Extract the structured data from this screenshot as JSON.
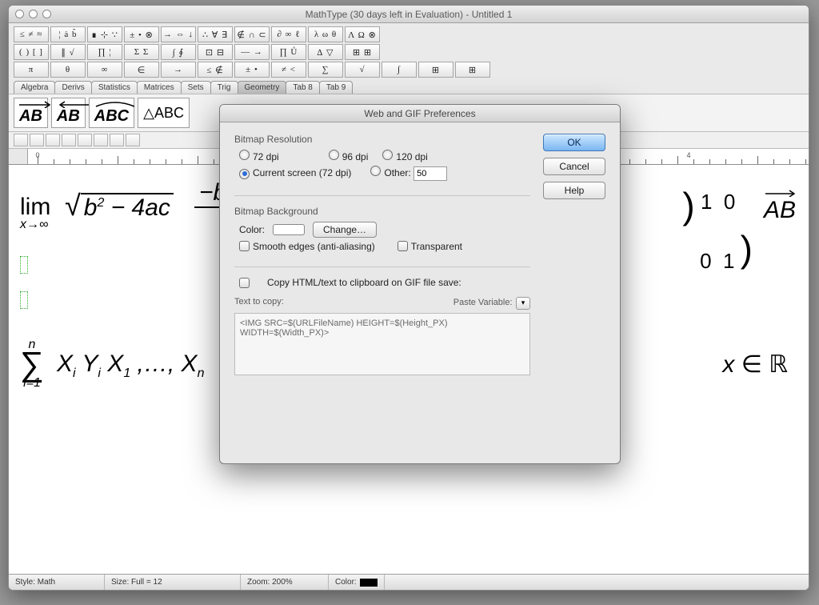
{
  "window": {
    "title": "MathType (30 days left in Evaluation) - Untitled 1"
  },
  "palettes": {
    "row1": [
      "≤ ≠ ≈",
      "¦ ȧ b̂",
      "∎ ⊹ ∵",
      "± • ⊗",
      "→ ⇔ ↓",
      "∴ ∀ ∃",
      "∉ ∩ ⊂",
      "∂ ∞ ℓ",
      "λ ω θ",
      "Λ Ω ⊗"
    ],
    "row2": [
      "( ) [ ]",
      "∥ √",
      "∏ ¦",
      "Σ Σ",
      "∫ ∮",
      "⊡ ⊟",
      "— →",
      "∏ Ů",
      "∆ ▽",
      "⊞ ⊞"
    ],
    "row3": [
      "π",
      "θ",
      "∞",
      "∈",
      "→",
      "≤ ∉",
      "± •",
      "≠ <",
      "∑",
      "√",
      "∫",
      "⊞",
      "⊞"
    ]
  },
  "tabs": [
    "Algebra",
    "Derivs",
    "Statistics",
    "Matrices",
    "Sets",
    "Trig",
    "Geometry",
    "Tab 8",
    "Tab 9"
  ],
  "active_tab": 6,
  "templates": {
    "t1": "AB",
    "t2": "AB",
    "t3": "ABC",
    "t4": "△ABC"
  },
  "ruler_numbers": [
    "0",
    "4"
  ],
  "equations": {
    "lim": "lim",
    "lim_sub": "x→∞",
    "sqrt_inner": "b² − 4ac",
    "frac_num": "−b ±",
    "sum_top": "n",
    "sum_bot": "i=1",
    "sum_body": "X<sub>i</sub> Y<sub>i</sub> X<sub>1</sub> ,…, X<sub>n</sub>",
    "frac2_num": "x",
    "matrix": "1  0\n0  1",
    "vec": "AB",
    "xinr": "x ∈ ℝ"
  },
  "status": {
    "style_label": "Style:",
    "style_value": "Math",
    "size_label": "Size:",
    "size_value": "Full = 12",
    "zoom_label": "Zoom:",
    "zoom_value": "200%",
    "color_label": "Color:"
  },
  "dialog": {
    "title": "Web and GIF Preferences",
    "ok": "OK",
    "cancel": "Cancel",
    "help": "Help",
    "sec1_title": "Bitmap Resolution",
    "opt_72": "72 dpi",
    "opt_96": "96 dpi",
    "opt_120": "120 dpi",
    "opt_current": "Current screen (72 dpi)",
    "opt_other": "Other:",
    "other_value": "50",
    "sec2_title": "Bitmap Background",
    "color_label": "Color:",
    "change_btn": "Change…",
    "smooth": "Smooth edges (anti-aliasing)",
    "transparent": "Transparent",
    "copy_check": "Copy HTML/text to clipboard on GIF file save:",
    "text_to_copy_label": "Text to copy:",
    "paste_var_label": "Paste Variable:",
    "textarea_value": "<IMG SRC=$(URLFileName) HEIGHT=$(Height_PX) WIDTH=$(Width_PX)>"
  }
}
